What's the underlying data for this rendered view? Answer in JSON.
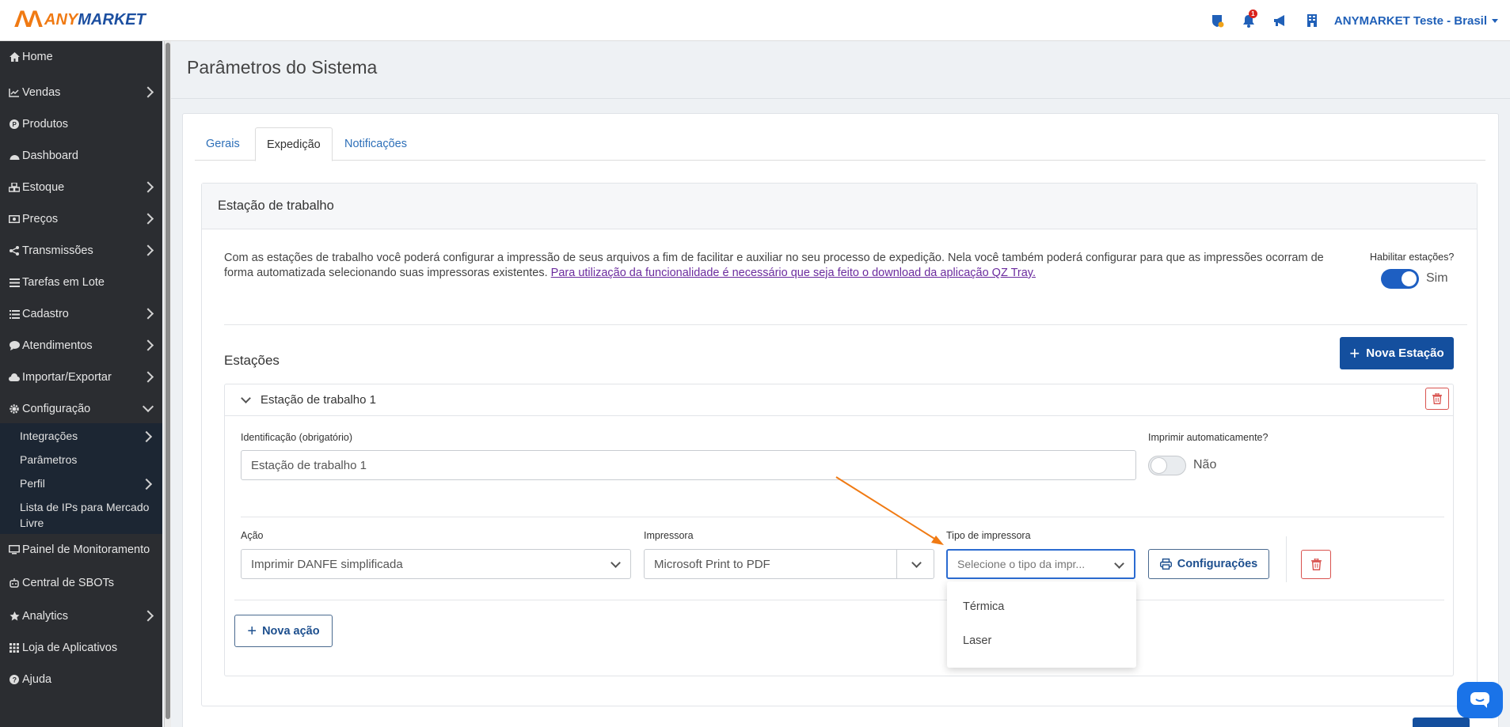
{
  "brand": {
    "mark": "ΛΛ",
    "name_part1": "ANY",
    "name_part2": "MARKET",
    "color_orange": "#f07a13",
    "color_blue": "#1c4fa0"
  },
  "topbar": {
    "notification_count": "1",
    "account_label": "ANYMARKET Teste - Brasil",
    "icons": [
      "shield-alert-icon",
      "bell-icon",
      "megaphone-icon",
      "building-icon"
    ]
  },
  "sidebar": {
    "items": [
      {
        "label": "Home",
        "icon": "home-icon"
      },
      {
        "label": "Vendas",
        "icon": "chart-line-icon"
      },
      {
        "label": "Produtos",
        "icon": "product-icon"
      },
      {
        "label": "Dashboard",
        "icon": "dashboard-icon"
      },
      {
        "label": "Estoque",
        "icon": "boxes-icon"
      },
      {
        "label": "Preços",
        "icon": "money-icon"
      },
      {
        "label": "Transmissões",
        "icon": "share-icon"
      },
      {
        "label": "Tarefas em Lote",
        "icon": "list-icon"
      },
      {
        "label": "Cadastro",
        "icon": "list-icon"
      },
      {
        "label": "Atendimentos",
        "icon": "chat-icon"
      },
      {
        "label": "Importar/Exportar",
        "icon": "cloud-icon"
      },
      {
        "label": "Configuração",
        "icon": "gear-icon"
      },
      {
        "label": "Painel de Monitoramento",
        "icon": "monitor-icon"
      },
      {
        "label": "Central de SBOTs",
        "icon": "robot-icon"
      },
      {
        "label": "Analytics",
        "icon": "star-icon"
      },
      {
        "label": "Loja de Aplicativos",
        "icon": "grid-icon"
      },
      {
        "label": "Ajuda",
        "icon": "help-icon"
      }
    ],
    "sub_items": [
      "Integrações",
      "Parâmetros",
      "Perfil",
      "Lista de IPs para Mercado",
      "Livre"
    ]
  },
  "page": {
    "title": "Parâmetros do Sistema",
    "tabs": [
      "Gerais",
      "Expedição",
      "Notificações"
    ],
    "active_tab": "Expedição"
  },
  "workstation": {
    "header": "Estação de trabalho",
    "description": "Com as estações de trabalho você poderá configurar a impressão de seus arquivos a fim de facilitar e auxiliar no seu processo de expedição. Nela você também poderá configurar para que as impressões ocorram de forma automatizada selecionando suas impressoras existentes. ",
    "description_link": "Para utilização da funcionalidade é necessário que seja feito o download da aplicação QZ Tray.",
    "enable_label": "Habilitar estações?",
    "enable_value": "Sim",
    "enabled": true
  },
  "stations": {
    "title": "Estações",
    "new_button": "Nova Estação",
    "station_name": "Estação de trabalho 1",
    "id_label": "Identificação (obrigatório)",
    "id_value": "Estação de trabalho 1",
    "auto_print_label": "Imprimir automaticamente?",
    "auto_print_value": "Não",
    "auto_print": false,
    "action_label": "Ação",
    "action_value": "Imprimir DANFE simplificada",
    "printer_label": "Impressora",
    "printer_value": "Microsoft Print to PDF",
    "printer_type_label": "Tipo de impressora",
    "printer_type_placeholder": "Selecione o tipo da impr...",
    "config_button": "Configurações",
    "new_action_button": "Nova ação",
    "printer_type_options": [
      "Térmica",
      "Laser"
    ]
  },
  "colors": {
    "primary": "#144f9e",
    "danger": "#d9534f",
    "accent_arrow": "#f07a13",
    "sidebar_bg": "#2b2d31"
  }
}
